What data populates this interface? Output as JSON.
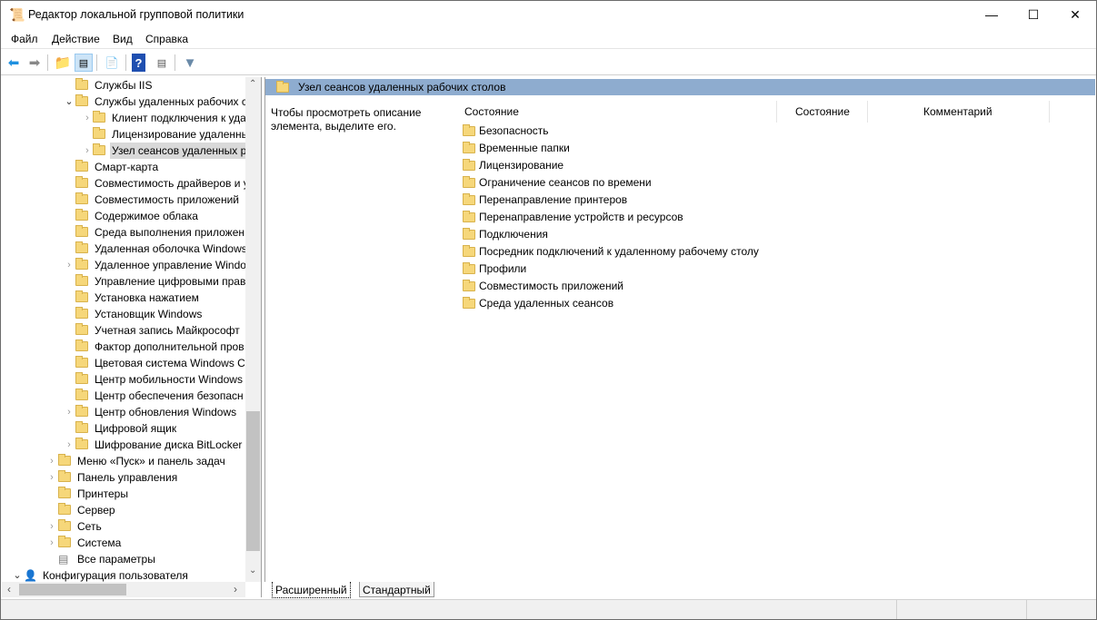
{
  "window": {
    "title": "Редактор локальной групповой политики",
    "minimize": "—",
    "maximize": "☐",
    "close": "✕"
  },
  "menu": [
    "Файл",
    "Действие",
    "Вид",
    "Справка"
  ],
  "tree": [
    {
      "label": "Службы IIS",
      "level": 2,
      "chevron": ""
    },
    {
      "label": "Службы удаленных рабочих с",
      "level": 2,
      "chevron": "open"
    },
    {
      "label": "Клиент подключения к уда",
      "level": 3,
      "chevron": "closed"
    },
    {
      "label": "Лицензирование удаленны",
      "level": 3,
      "chevron": ""
    },
    {
      "label": "Узел сеансов удаленных ра",
      "level": 3,
      "chevron": "closed",
      "selected": true
    },
    {
      "label": "Смарт-карта",
      "level": 2,
      "chevron": ""
    },
    {
      "label": "Совместимость драйверов и у",
      "level": 2,
      "chevron": ""
    },
    {
      "label": "Совместимость приложений",
      "level": 2,
      "chevron": ""
    },
    {
      "label": "Содержимое облака",
      "level": 2,
      "chevron": ""
    },
    {
      "label": "Среда выполнения приложен",
      "level": 2,
      "chevron": ""
    },
    {
      "label": "Удаленная оболочка Windows",
      "level": 2,
      "chevron": ""
    },
    {
      "label": "Удаленное управление Windo",
      "level": 2,
      "chevron": "closed"
    },
    {
      "label": "Управление цифровыми прав",
      "level": 2,
      "chevron": ""
    },
    {
      "label": "Установка нажатием",
      "level": 2,
      "chevron": ""
    },
    {
      "label": "Установщик Windows",
      "level": 2,
      "chevron": ""
    },
    {
      "label": "Учетная запись Майкрософт",
      "level": 2,
      "chevron": ""
    },
    {
      "label": "Фактор дополнительной пров",
      "level": 2,
      "chevron": ""
    },
    {
      "label": "Цветовая система Windows Co",
      "level": 2,
      "chevron": ""
    },
    {
      "label": "Центр мобильности Windows",
      "level": 2,
      "chevron": ""
    },
    {
      "label": "Центр обеспечения безопасн",
      "level": 2,
      "chevron": ""
    },
    {
      "label": "Центр обновления Windows",
      "level": 2,
      "chevron": "closed"
    },
    {
      "label": "Цифровой ящик",
      "level": 2,
      "chevron": ""
    },
    {
      "label": "Шифрование диска BitLocker",
      "level": 2,
      "chevron": "closed"
    },
    {
      "label": "Меню «Пуск» и панель задач",
      "level": 1,
      "chevron": "closed"
    },
    {
      "label": "Панель управления",
      "level": 1,
      "chevron": "closed"
    },
    {
      "label": "Принтеры",
      "level": 1,
      "chevron": ""
    },
    {
      "label": "Сервер",
      "level": 1,
      "chevron": ""
    },
    {
      "label": "Сеть",
      "level": 1,
      "chevron": "closed"
    },
    {
      "label": "Система",
      "level": 1,
      "chevron": "closed"
    },
    {
      "label": "Все параметры",
      "level": 1,
      "chevron": "",
      "icon": "settings"
    },
    {
      "label": "Конфигурация пользователя",
      "level": 0,
      "chevron": "open",
      "icon": "user"
    }
  ],
  "main": {
    "header": "Узел сеансов удаленных рабочих столов",
    "description": "Чтобы просмотреть описание элемента, выделите его.",
    "columns": [
      "Состояние",
      "Состояние",
      "Комментарий"
    ],
    "items": [
      "Безопасность",
      "Временные папки",
      "Лицензирование",
      "Ограничение сеансов по времени",
      "Перенаправление принтеров",
      "Перенаправление устройств и ресурсов",
      "Подключения",
      "Посредник подключений к удаленному рабочему столу",
      "Профили",
      "Совместимость приложений",
      "Среда удаленных сеансов"
    ]
  },
  "tabs": [
    "Расширенный",
    "Стандартный"
  ]
}
